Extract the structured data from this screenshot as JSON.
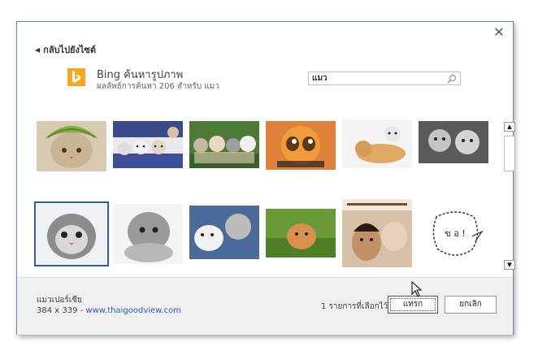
{
  "dialog": {
    "close_label": "✕",
    "back_label": "กลับไปยังไซต์",
    "bing_title": "Bing ค้นหารูปภาพ",
    "bing_subtitle": "ผลลัพธ์การค้นหา 206 สำหรับ แมว",
    "search_value": "แมว",
    "brand_color": "#f5a623",
    "selection_color": "#2b5aa8"
  },
  "images": [
    {
      "name": "kitten-melon-hat"
    },
    {
      "name": "kittens-in-basket"
    },
    {
      "name": "four-kittens-grass"
    },
    {
      "name": "puss-in-boots-cartoon"
    },
    {
      "name": "kitten-and-puppy"
    },
    {
      "name": "two-grey-kittens"
    },
    {
      "name": "grey-kitten-selected"
    },
    {
      "name": "fluffy-kitten"
    },
    {
      "name": "kitten-with-toy"
    },
    {
      "name": "orange-kitten-grass"
    },
    {
      "name": "boy-with-kitten"
    },
    {
      "name": "doodle-sketch"
    }
  ],
  "footer": {
    "file_name": "แมวเปอร์เซีย",
    "dimensions": "384 x 339 - ",
    "source": "www.thaigoodview.com",
    "selected_count": "1 รายการที่เลือกไว้",
    "insert_label": "แทรก",
    "cancel_label": "ยกเลิก"
  }
}
